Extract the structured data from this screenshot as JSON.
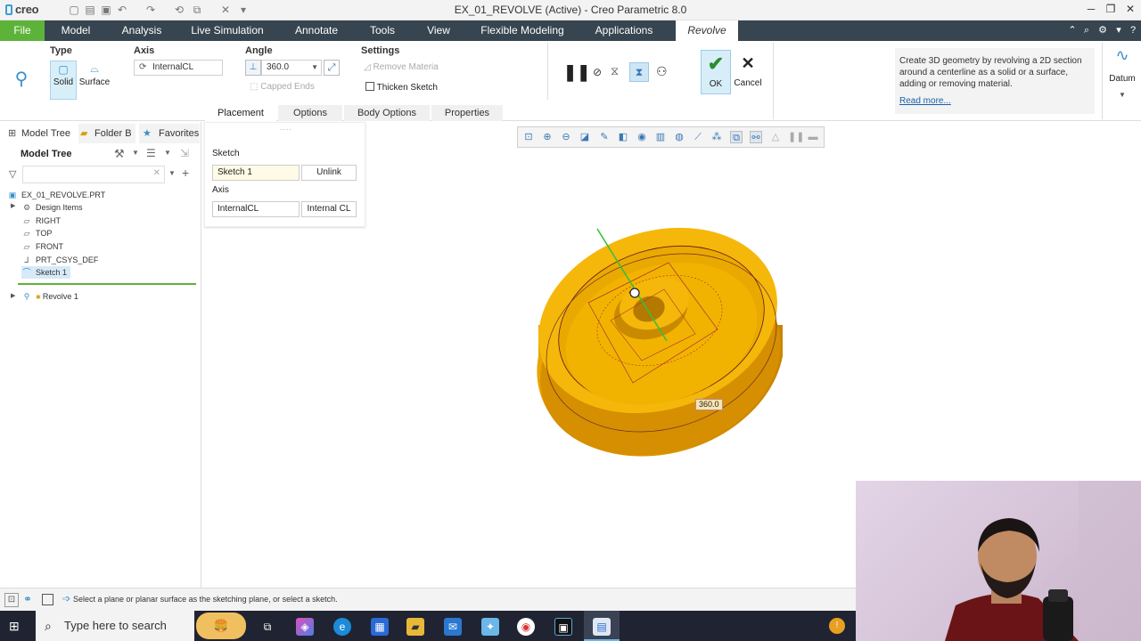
{
  "app": {
    "logo": "creo",
    "window_title": "EX_01_REVOLVE (Active) - Creo Parametric 8.0"
  },
  "ribbon": {
    "tabs": [
      "File",
      "Model",
      "Analysis",
      "Live Simulation",
      "Annotate",
      "Tools",
      "View",
      "Flexible Modeling",
      "Applications",
      "Revolve"
    ]
  },
  "dashboard": {
    "type": {
      "title": "Type",
      "solid": "Solid",
      "surface": "Surface"
    },
    "axis": {
      "title": "Axis",
      "value": "InternalCL"
    },
    "angle": {
      "title": "Angle",
      "value": "360.0",
      "capped_ends": "Capped Ends"
    },
    "settings": {
      "title": "Settings",
      "remove_material": "Remove Materia",
      "thicken_sketch": "Thicken Sketch"
    },
    "ok": "OK",
    "cancel": "Cancel",
    "help_text": "Create 3D geometry by revolving a 2D section around a centerline as a solid or a surface, adding or removing material.",
    "help_link": "Read more...",
    "datum": "Datum",
    "subtabs": [
      "Placement",
      "Options",
      "Body Options",
      "Properties"
    ]
  },
  "left_panel": {
    "tabs": [
      "Model Tree",
      "Folder B",
      "Favorites"
    ],
    "tree_title": "Model Tree",
    "items": [
      {
        "label": "EX_01_REVOLVE.PRT",
        "icon": "part-icon"
      },
      {
        "label": "Design Items",
        "icon": "design-items-icon"
      },
      {
        "label": "RIGHT",
        "icon": "datum-plane-icon"
      },
      {
        "label": "TOP",
        "icon": "datum-plane-icon"
      },
      {
        "label": "FRONT",
        "icon": "datum-plane-icon"
      },
      {
        "label": "PRT_CSYS_DEF",
        "icon": "csys-icon"
      },
      {
        "label": "Sketch 1",
        "icon": "sketch-icon"
      },
      {
        "label": "Revolve 1",
        "icon": "revolve-icon"
      }
    ]
  },
  "placement_panel": {
    "sketch_label": "Sketch",
    "sketch_value": "Sketch 1",
    "unlink": "Unlink",
    "axis_label": "Axis",
    "axis_value": "InternalCL",
    "axis_type": "Internal CL"
  },
  "graphics": {
    "angle_tag": "360.0"
  },
  "status": {
    "message": "Select a plane or planar surface as the sketching plane, or select a sketch."
  },
  "taskbar": {
    "search_placeholder": "Type here to search"
  },
  "colors": {
    "ribbon_bg": "#36454f",
    "file_tab": "#5db339",
    "model_yellow": "#f5b70a",
    "ok_green": "#2e8b2e"
  }
}
